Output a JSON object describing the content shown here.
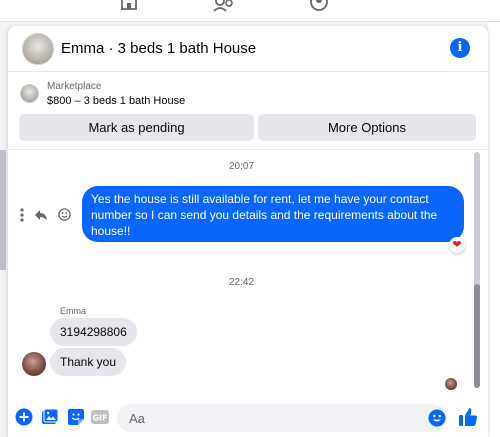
{
  "conversation": {
    "title": "Emma · 3 beds 1 bath House"
  },
  "marketplace": {
    "label": "Marketplace",
    "listing": "$800 – 3 beds 1 bath House",
    "pending_label": "Mark as pending",
    "more_label": "More Options"
  },
  "messages": {
    "time1": "20:07",
    "outgoing": "Yes the house is still available for rent, let me have your contact number so I can send you details and the requirements about the house!!",
    "time2": "22:42",
    "sender_name": "Emma",
    "incoming1": "3194298806",
    "incoming2": "Thank you"
  },
  "composer": {
    "placeholder": "Aa"
  },
  "icons": {
    "info": "info-icon",
    "more": "more-vertical-icon",
    "reply": "reply-icon",
    "react": "smile-icon",
    "reaction": "heart-icon",
    "plus": "plus-circle-icon",
    "photo": "photo-icon",
    "sticker": "sticker-icon",
    "gif": "gif-icon",
    "emoji": "emoji-icon",
    "like": "thumbs-up-icon"
  },
  "colors": {
    "accent": "#0866ff",
    "bubble_in": "#e4e6eb",
    "reaction": "#e41e3f"
  }
}
